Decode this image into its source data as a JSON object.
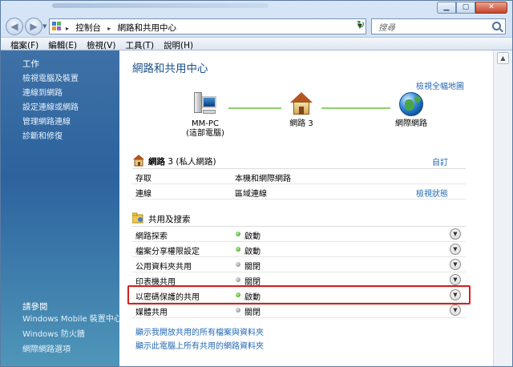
{
  "address_bar": {
    "crumbs": [
      "控制台",
      "網路和共用中心"
    ],
    "separator": "▸"
  },
  "search": {
    "placeholder": "搜尋"
  },
  "menu": [
    "檔案(F)",
    "編輯(E)",
    "檢視(V)",
    "工具(T)",
    "說明(H)"
  ],
  "sidebar": {
    "tasks_title": "工作",
    "tasks": [
      "檢視電腦及裝置",
      "連線到網路",
      "設定連線或網路",
      "管理網路連線",
      "診斷和修復"
    ],
    "see_also_title": "請參閱",
    "see_also": [
      "Windows Mobile 裝置中心",
      "Windows 防火牆",
      "網際網路選項"
    ]
  },
  "main": {
    "title": "網路和共用中心",
    "view_full_map": "檢視全幅地圖",
    "map": {
      "computer_name": "MM-PC",
      "computer_sub": "(這部電腦)",
      "network_name": "網路 3",
      "internet": "網際網路"
    },
    "network": {
      "name": "網路",
      "name_num": "3 (私人網路)",
      "customize": "自訂",
      "rows": [
        {
          "label": "存取",
          "value": "本機和網際網路",
          "link": ""
        },
        {
          "label": "連線",
          "value": "區域連線",
          "link": "檢視狀態"
        }
      ]
    },
    "sharing": {
      "title": "共用及搜索",
      "rows": [
        {
          "label": "網路探索",
          "state": "啟動",
          "on": true
        },
        {
          "label": "檔案分享權限設定",
          "state": "啟動",
          "on": true
        },
        {
          "label": "公用資料夾共用",
          "state": "關閉",
          "on": false
        },
        {
          "label": "印表機共用",
          "state": "關閉",
          "on": false
        },
        {
          "label": "以密碼保護的共用",
          "state": "啟動",
          "on": true
        },
        {
          "label": "媒體共用",
          "state": "關閉",
          "on": false
        }
      ]
    },
    "bottom_links": [
      "顯示我開放共用的所有檔案與資料夾",
      "顯示此電腦上所有共用的網路資料夾"
    ]
  },
  "colors": {
    "accent": "#1d5289",
    "link": "#2469b3",
    "highlight": "#d2201e",
    "on": "#2e9a12"
  }
}
